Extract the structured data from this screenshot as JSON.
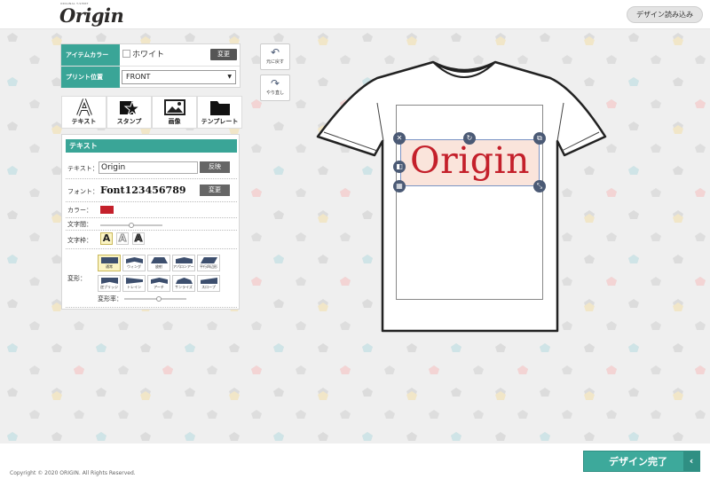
{
  "header": {
    "logo_text": "Origin",
    "logo_tagline": "ORIGINAL T-SHIRT",
    "load_design_label": "デザイン読み込み"
  },
  "item_settings": {
    "item_color_label": "アイテムカラー",
    "item_color_value": "ホワイト",
    "item_color_checked": false,
    "change_label": "変更",
    "print_position_label": "プリント位置",
    "print_position_value": "FRONT"
  },
  "tabs": [
    {
      "label": "テキスト",
      "icon": "text-a-icon"
    },
    {
      "label": "スタンプ",
      "icon": "stamp-star-icon"
    },
    {
      "label": "画像",
      "icon": "image-icon"
    },
    {
      "label": "テンプレート",
      "icon": "folder-icon"
    }
  ],
  "text_panel": {
    "header": "テキスト",
    "text_label": "テキスト：",
    "text_value": "Origin",
    "reflect_label": "反映",
    "font_label": "フォント：",
    "font_sample": "Font123456789",
    "font_change_label": "変更",
    "color_label": "カラー：",
    "color_value": "#c4202b",
    "spacing_label": "文字間：",
    "spacing_level": 0.5,
    "frame_label": "文字枠：",
    "frame_options": [
      "A",
      "A",
      "A"
    ],
    "warp_label": "変形：",
    "warp_options": [
      "通常",
      "ウィング",
      "放射",
      "アパロンアーチ",
      "平行四辺形",
      "逆ブリッジ",
      "トレイン",
      "アーチ",
      "サンライズ",
      "スロープ"
    ],
    "warp_selected": "通常",
    "warp_rate_label": "変形率：",
    "warp_rate_level": 0.55
  },
  "actions": {
    "undo_label": "元に戻す",
    "redo_label": "やり直し"
  },
  "canvas": {
    "design_text": "Origin",
    "design_color": "#c4202b"
  },
  "footer": {
    "copyright": "Copyright © 2020 ORIGIN. All Rights Reserved.",
    "done_label": "デザイン完了"
  }
}
